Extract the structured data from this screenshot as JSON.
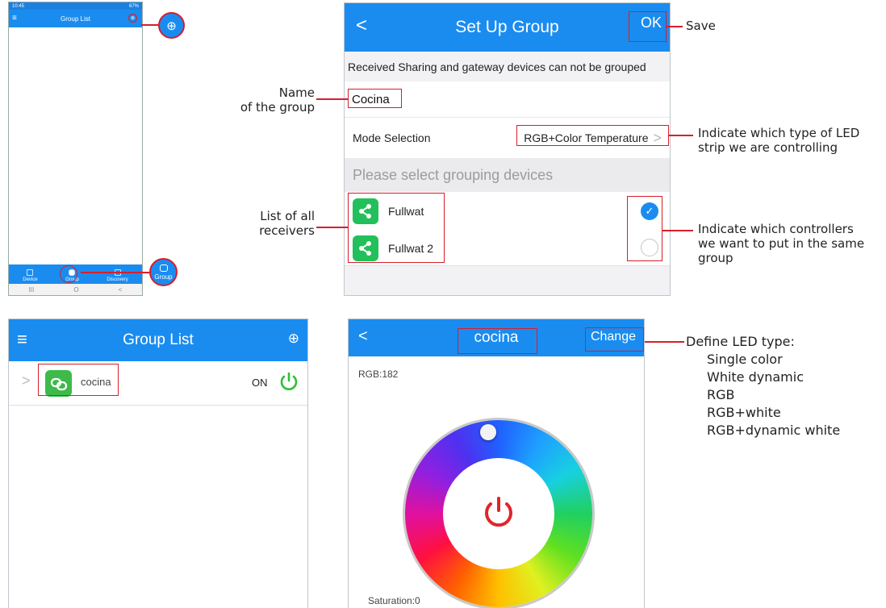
{
  "phone": {
    "status_time": "10:45",
    "status_right": "67%",
    "title": "Group List",
    "tabs": [
      "Device",
      "Group",
      "Discovery"
    ],
    "nav_glyphs": [
      "III",
      "O",
      "<"
    ],
    "zoom_group_label": "Group"
  },
  "setup": {
    "title": "Set Up Group",
    "ok_label": "OK",
    "notice": "Received Sharing and gateway devices can not be grouped",
    "group_name": "Cocina",
    "mode_label": "Mode Selection",
    "mode_value": "RGB+Color Temperature",
    "select_prompt": "Please select grouping devices",
    "devices": [
      {
        "name": "Fullwat",
        "checked": true
      },
      {
        "name": "Fullwat 2",
        "checked": false
      }
    ]
  },
  "grouplist": {
    "title": "Group List",
    "group_name": "cocina",
    "state": "ON"
  },
  "detail": {
    "title": "cocina",
    "change_label": "Change",
    "rgb_label": "RGB:182",
    "saturation_label": "Saturation:0"
  },
  "annotations": {
    "save": "Save",
    "name_line1": "Name",
    "name_line2": "of the group",
    "led_line1": "Indicate which type of LED",
    "led_line2": "strip we are controlling",
    "receivers_line1": "List of all",
    "receivers_line2": "receivers",
    "ctrl_line1": "Indicate which controllers",
    "ctrl_line2": "we want to put in the same",
    "ctrl_line3": "group",
    "define_title": "Define LED type:",
    "led_types": [
      "Single color",
      "White dynamic",
      "RGB",
      "RGB+white",
      "RGB+dynamic white"
    ]
  },
  "colors": {
    "header_blue": "#1a8cf0",
    "highlight_red": "#d61f2a",
    "share_green": "#22c05a",
    "power_red": "#e0252b",
    "power_green": "#2fbf3a"
  }
}
